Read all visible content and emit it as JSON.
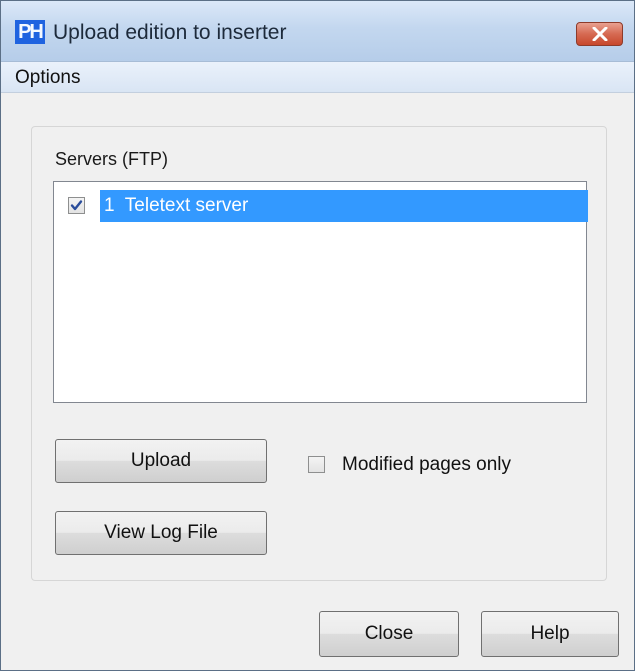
{
  "window": {
    "app_icon_text": "PH",
    "title": "Upload edition to inserter",
    "close_icon": "close-icon"
  },
  "menu": {
    "items": [
      {
        "label": "Options"
      }
    ]
  },
  "servers": {
    "group_label": "Servers (FTP)",
    "items": [
      {
        "label": "1  Teletext server",
        "checked": true,
        "selected": true
      }
    ]
  },
  "actions": {
    "upload_label": "Upload",
    "view_log_label": "View Log File",
    "modified_only_label": "Modified pages only",
    "modified_only_checked": false
  },
  "footer": {
    "close_label": "Close",
    "help_label": "Help"
  },
  "colors": {
    "selection": "#3399ff",
    "close_button": "#c7472c",
    "app_icon": "#1f63e0"
  }
}
